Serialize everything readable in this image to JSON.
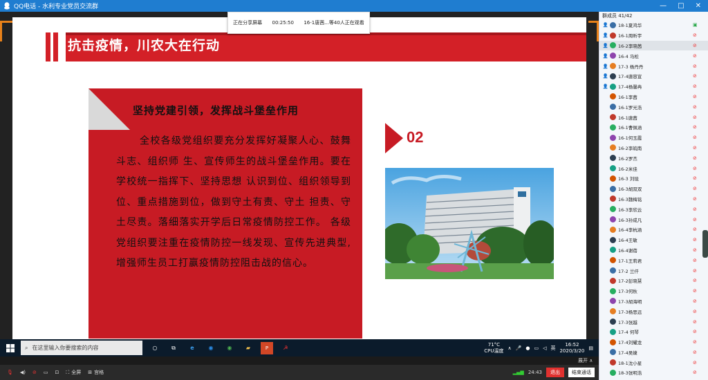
{
  "window": {
    "title": "QQ电话 - 水利专业党员交流群",
    "min": "—",
    "max": "□",
    "close": "✕"
  },
  "share_bar": {
    "status": "正在分享屏幕",
    "time": "00:25:50",
    "viewers": "16-1唐茜...等40人正在观看"
  },
  "slide": {
    "title": "抗击疫情，川农大在行动",
    "heading": "坚持党建引领，发挥战斗堡垒作用",
    "body": "全校各级党组织要充分发挥好凝聚人心、鼓舞斗志、组织师 生、宣传师生的战斗堡垒作用。要在学校统一指挥下、坚持思想 认识到位、组织领导到位、重点措施到位，做到守土有责、守土 担责、守土尽责。落细落实开学后日常疫情防控工作。 各级党组织要注重在疫情防控一线发现、宣传先进典型,增强师生员工打赢疫情防控阻击战的信心。",
    "number": "02",
    "accent": "#c71b24"
  },
  "taskbar": {
    "search_placeholder": "在这里输入你要搜索的内容",
    "weather_temp": "71°C",
    "weather_label": "CPU温度",
    "ime": "英",
    "time": "16:52",
    "date": "2020/3/20"
  },
  "toolbar": {
    "fullscreen": "全屏",
    "grid": "宫格",
    "signal": "24:43",
    "exit": "退出",
    "end": "结束通话",
    "expand": "展开 ∧"
  },
  "members": {
    "header": "群成员 41/42",
    "list": [
      "18-1夏鸿华",
      "16-1周昕宇",
      "16-2李晓茜",
      "16-4 马松",
      "17-3 杨丹丹",
      "17-4唐容宣",
      "17-4杨馨冉",
      "16-1李茜",
      "16-1罗光浩",
      "16-1唐茜",
      "16-1曹佩涵",
      "16-1何玉霞",
      "16-2李皖南",
      "16-2罗杰",
      "16-2米佳",
      "16-3 刘珑",
      "16-3胡双双",
      "16-3魏梅铭",
      "16-3李欣云",
      "16-3孙成凡",
      "16-4李杭涵",
      "16-4王敏",
      "16-4谢蓓",
      "17-1王莉君",
      "17-2 兰仟",
      "17-2彭晓慧",
      "17-3何秋",
      "17-3胡海明",
      "17-3杨思远",
      "17-3张越",
      "17-4 何琴",
      "17-4刘耀龙",
      "17-4吴婕",
      "18-1沈小星",
      "18-3张明浩"
    ]
  }
}
